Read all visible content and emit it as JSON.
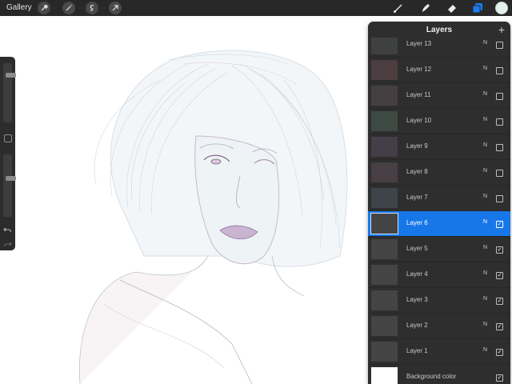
{
  "toolbar": {
    "gallery_label": "Gallery",
    "left_tools": [
      "wrench-icon",
      "magic-wand-icon",
      "selection-s-icon",
      "transform-arrow-icon"
    ],
    "right_tools": [
      "brush-icon",
      "smudge-icon",
      "eraser-icon",
      "layers-icon"
    ],
    "accent_color": "#1a7cf0",
    "current_color": "#e4f1ee"
  },
  "sidebar": {
    "brush_size_level": 0.82,
    "opacity_level": 0.62
  },
  "layers_panel": {
    "title": "Layers",
    "layers": [
      {
        "name": "Layer 13",
        "mode": "N",
        "visible": false,
        "selected": false,
        "thumb": "#3e4140"
      },
      {
        "name": "Layer 12",
        "mode": "N",
        "visible": false,
        "selected": false,
        "thumb": "#4b3d40"
      },
      {
        "name": "Layer 11",
        "mode": "N",
        "visible": false,
        "selected": false,
        "thumb": "#453f42"
      },
      {
        "name": "Layer 10",
        "mode": "N",
        "visible": false,
        "selected": false,
        "thumb": "#3d4a43"
      },
      {
        "name": "Layer 9",
        "mode": "N",
        "visible": false,
        "selected": false,
        "thumb": "#433e47"
      },
      {
        "name": "Layer 8",
        "mode": "N",
        "visible": false,
        "selected": false,
        "thumb": "#473f44"
      },
      {
        "name": "Layer 7",
        "mode": "N",
        "visible": false,
        "selected": false,
        "thumb": "#3e4449"
      },
      {
        "name": "Layer 6",
        "mode": "N",
        "visible": true,
        "selected": true,
        "thumb": "#444444"
      },
      {
        "name": "Layer 5",
        "mode": "N",
        "visible": true,
        "selected": false,
        "thumb": "#444444"
      },
      {
        "name": "Layer 4",
        "mode": "N",
        "visible": true,
        "selected": false,
        "thumb": "#444444"
      },
      {
        "name": "Layer 3",
        "mode": "N",
        "visible": true,
        "selected": false,
        "thumb": "#444444"
      },
      {
        "name": "Layer 2",
        "mode": "N",
        "visible": true,
        "selected": false,
        "thumb": "#444444"
      },
      {
        "name": "Layer 1",
        "mode": "N",
        "visible": true,
        "selected": false,
        "thumb": "#444444"
      }
    ],
    "background": {
      "name": "Background color",
      "visible": true,
      "color": "#ffffff"
    }
  }
}
